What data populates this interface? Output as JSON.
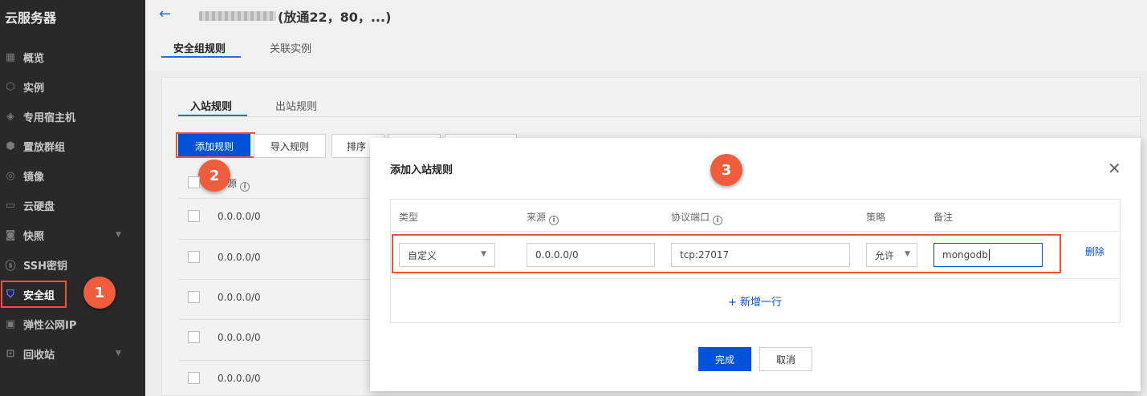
{
  "sidebar": {
    "title": "云服务器",
    "items": [
      {
        "label": "概览",
        "icon": "grid-icon",
        "glyph": "▦"
      },
      {
        "label": "实例",
        "icon": "cube-icon",
        "glyph": "⬡"
      },
      {
        "label": "专用宿主机",
        "icon": "layers-icon",
        "glyph": "◈"
      },
      {
        "label": "置放群组",
        "icon": "hexagon-icon",
        "glyph": "⬢"
      },
      {
        "label": "镜像",
        "icon": "disc-icon",
        "glyph": "◎"
      },
      {
        "label": "云硬盘",
        "icon": "drive-icon",
        "glyph": "▭"
      },
      {
        "label": "快照",
        "icon": "camera-icon",
        "glyph": "◙"
      },
      {
        "label": "SSH密钥",
        "icon": "key-icon",
        "glyph": "ⓢ"
      },
      {
        "label": "安全组",
        "icon": "shield-icon",
        "glyph": "⛉"
      },
      {
        "label": "弹性公网IP",
        "icon": "ip-icon",
        "glyph": "▣"
      },
      {
        "label": "回收站",
        "icon": "trash-icon",
        "glyph": "⊡"
      }
    ]
  },
  "header": {
    "title": "(放通22，80，...)",
    "tabs": [
      "安全组规则",
      "关联实例"
    ]
  },
  "rules": {
    "tabs": [
      "入站规则",
      "出站规则"
    ],
    "toolbar": {
      "add": "添加规则",
      "import": "导入规则",
      "sort": "排序"
    },
    "source_header": "源",
    "rows": [
      "0.0.0.0/0",
      "0.0.0.0/0",
      "0.0.0.0/0",
      "0.0.0.0/0",
      "0.0.0.0/0"
    ]
  },
  "dialog": {
    "title": "添加入站规则",
    "columns": {
      "type": "类型",
      "source": "来源",
      "port": "协议端口",
      "policy": "策略",
      "note": "备注"
    },
    "row": {
      "type": "自定义",
      "source": "0.0.0.0/0",
      "port": "tcp:27017",
      "policy": "允许",
      "note": "mongodb",
      "delete": "删除"
    },
    "add_row": "+ 新增一行",
    "confirm": "完成",
    "cancel": "取消"
  },
  "annotations": [
    "1",
    "2",
    "3"
  ],
  "colors": {
    "primary": "#0052d9",
    "highlight": "#e8553a",
    "badge": "#ef5d3c",
    "sidebar": "#292929"
  }
}
